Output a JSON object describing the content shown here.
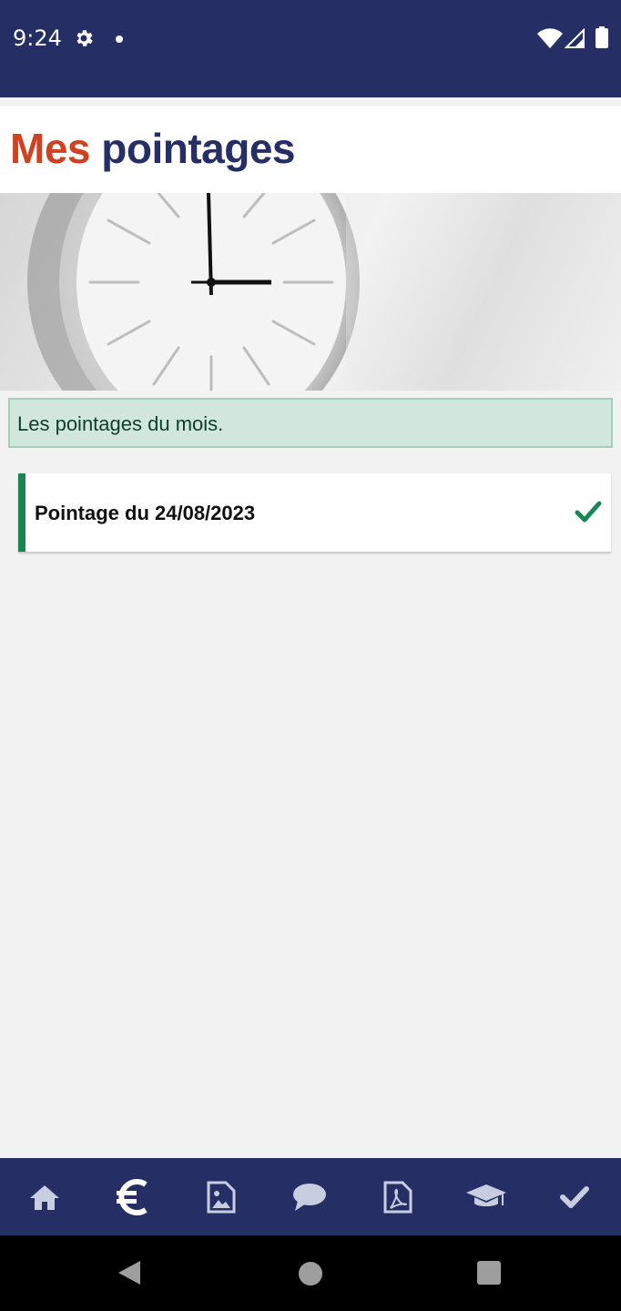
{
  "status_bar": {
    "time": "9:24",
    "icons": [
      "gear-icon",
      "notification-dot-icon",
      "wifi-icon",
      "signal-icon",
      "battery-icon"
    ]
  },
  "header": {
    "title_part1": "Mes",
    "title_part2": "pointages",
    "title_part1_color": "#d1401f",
    "title_part2_color": "#252f65"
  },
  "info": {
    "text": "Les pointages du mois."
  },
  "list": {
    "items": [
      {
        "label": "Pointage du 24/08/2023",
        "status_icon": "check-icon",
        "status_color": "#198754"
      }
    ]
  },
  "bottom_nav": {
    "items": [
      {
        "icon": "home-icon"
      },
      {
        "icon": "euro-icon"
      },
      {
        "icon": "image-file-icon"
      },
      {
        "icon": "chat-bubble-icon"
      },
      {
        "icon": "pdf-file-icon"
      },
      {
        "icon": "graduation-cap-icon"
      },
      {
        "icon": "check-icon"
      }
    ],
    "background": "#252f65"
  },
  "system_nav": {
    "items": [
      "back-icon",
      "home-circle-icon",
      "recents-icon"
    ]
  }
}
